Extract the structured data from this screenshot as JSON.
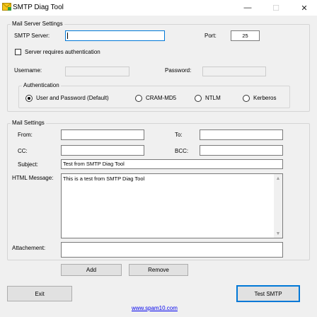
{
  "window": {
    "title": "SMTP Diag Tool",
    "minimize_glyph": "—",
    "maximize_glyph": "☐",
    "close_glyph": "✕"
  },
  "mail_server": {
    "legend": "Mail Server Settings",
    "smtp_server_label": "SMTP Server:",
    "smtp_server_value": "",
    "port_label": "Port:",
    "port_value": "25",
    "auth_required_label": "Server requires authentication",
    "auth_required_checked": false,
    "username_label": "Username:",
    "username_value": "",
    "password_label": "Password:",
    "password_value": ""
  },
  "authentication": {
    "legend": "Authentication",
    "options": [
      {
        "label": "User and Password (Default)",
        "checked": true
      },
      {
        "label": "CRAM-MD5",
        "checked": false
      },
      {
        "label": "NTLM",
        "checked": false
      },
      {
        "label": "Kerberos",
        "checked": false
      }
    ]
  },
  "mail_settings": {
    "legend": "Mail Settings",
    "from_label": "From:",
    "from_value": "",
    "to_label": "To:",
    "to_value": "",
    "cc_label": "CC:",
    "cc_value": "",
    "bcc_label": "BCC:",
    "bcc_value": "",
    "subject_label": "Subject:",
    "subject_value": "Test from SMTP Diag Tool",
    "html_message_label": "HTML Message:",
    "html_message_value": "This is a test from SMTP Diag Tool",
    "attachment_label": "Attachement:",
    "add_label": "Add",
    "remove_label": "Remove"
  },
  "footer": {
    "exit_label": "Exit",
    "test_smtp_label": "Test SMTP",
    "link_text": "www.spam10.com"
  },
  "colors": {
    "accent": "#0078d7",
    "link": "#0000ee",
    "window_bg": "#f0f0f0"
  },
  "icons": {
    "app": "envelope-icon",
    "scroll_up": "chevron-up-icon",
    "scroll_down": "chevron-down-icon"
  }
}
